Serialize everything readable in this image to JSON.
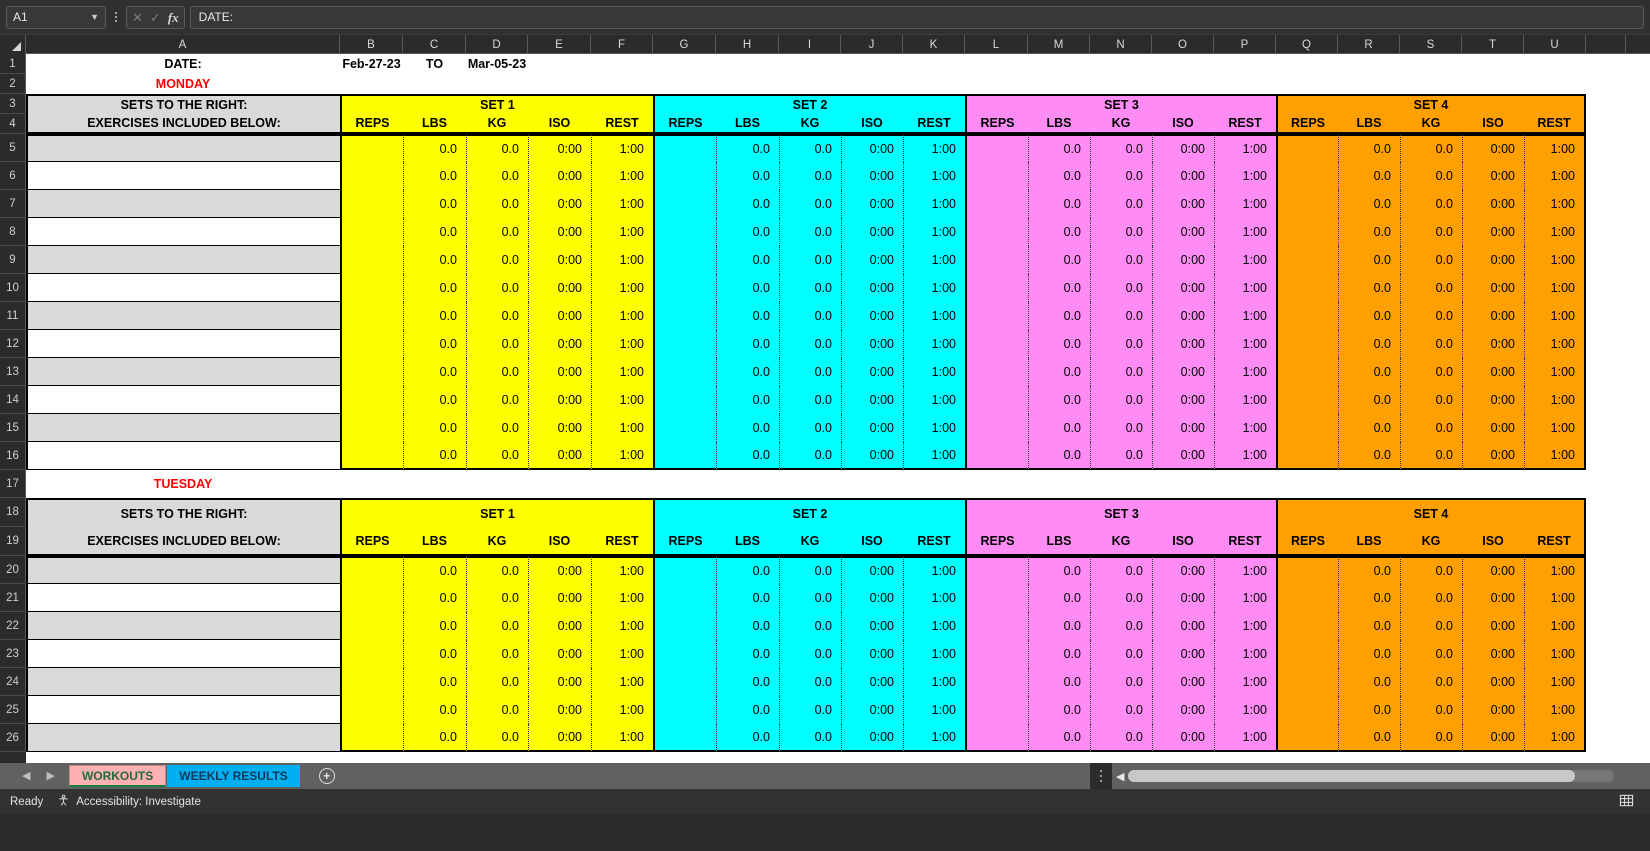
{
  "formula_bar": {
    "name_box_value": "A1",
    "cancel_icon": "close-icon",
    "confirm_icon": "check-icon",
    "fx_label": "fx",
    "formula_value": "DATE:"
  },
  "columns": [
    "A",
    "B",
    "C",
    "D",
    "E",
    "F",
    "G",
    "H",
    "I",
    "J",
    "K",
    "L",
    "M",
    "N",
    "O",
    "P",
    "Q",
    "R",
    "S",
    "T",
    "U"
  ],
  "row_numbers": [
    1,
    2,
    3,
    4,
    5,
    6,
    7,
    8,
    9,
    10,
    11,
    12,
    13,
    14,
    15,
    16,
    17,
    18,
    19,
    20,
    21,
    22,
    23,
    24,
    25,
    26
  ],
  "sheet": {
    "date_label": "DATE:",
    "date_from": "Feb-27-23",
    "date_to_label": "TO",
    "date_to": "Mar-05-23",
    "days": [
      "MONDAY",
      "TUESDAY"
    ],
    "section_header_line1": "SETS TO THE RIGHT:",
    "section_header_line2": "EXERCISES INCLUDED BELOW:",
    "sets": [
      {
        "title": "SET 1",
        "color": "#ffff00"
      },
      {
        "title": "SET 2",
        "color": "#00ffff"
      },
      {
        "title": "SET 3",
        "color": "#ff8cf5"
      },
      {
        "title": "SET 4",
        "color": "#ffa000"
      }
    ],
    "set_columns": [
      "REPS",
      "LBS",
      "KG",
      "ISO",
      "REST"
    ],
    "cell_values": {
      "reps": "",
      "lbs": "0.0",
      "kg": "0.0",
      "iso": "0:00",
      "rest": "1:00"
    },
    "monday_exercise_rows": 12,
    "tuesday_exercise_rows": 7
  },
  "tabs": {
    "prev_icon": "chevron-left-icon",
    "next_icon": "chevron-right-icon",
    "items": [
      {
        "label": "WORKOUTS",
        "active": true
      },
      {
        "label": "WEEKLY RESULTS",
        "active": false
      }
    ],
    "add_label": "+"
  },
  "status": {
    "ready": "Ready",
    "accessibility": "Accessibility: Investigate",
    "accessibility_icon": "accessibility-icon",
    "view_icon": "grid-view-icon"
  }
}
